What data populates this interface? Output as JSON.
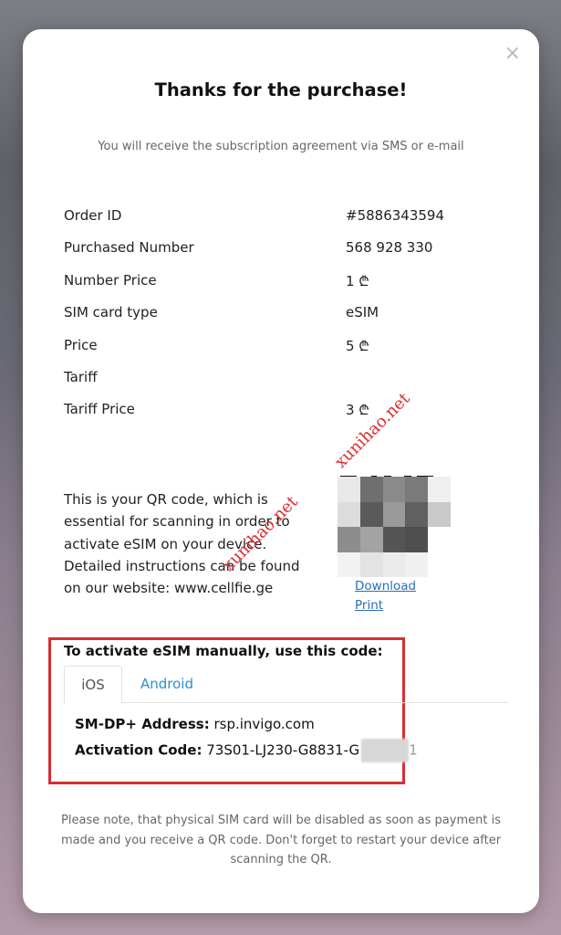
{
  "modal": {
    "close_label": "×",
    "title": "Thanks for the purchase!",
    "subtitle": "You will receive the subscription agreement via SMS or e-mail"
  },
  "order_details": [
    {
      "label": "Order ID",
      "value": "#5886343594"
    },
    {
      "label": "Purchased Number",
      "value": "568 928 330"
    },
    {
      "label": "Number Price",
      "value": "1 ₾"
    },
    {
      "label": "SIM card type",
      "value": "eSIM"
    },
    {
      "label": "Price",
      "value": "5 ₾"
    },
    {
      "label": "Tariff",
      "value": ""
    },
    {
      "label": "Tariff Price",
      "value": "3 ₾"
    }
  ],
  "qr_section": {
    "description": "This is your QR code, which is essential for scanning in order to activate eSIM on your device. Detailed instructions can be found on our website: www.cellfie.ge",
    "download_label": "Download",
    "print_label": "Print"
  },
  "manual_activation": {
    "title": "To activate eSIM manually, use this code:",
    "tabs": [
      "iOS",
      "Android"
    ],
    "active_tab": "iOS",
    "smdp_label": "SM-DP+ Address:",
    "smdp_value": "rsp.invigo.com",
    "activation_label": "Activation Code:",
    "activation_value": "73S01-LJ230-G8831-G",
    "activation_tail": "1"
  },
  "footer_note": "Please note, that physical SIM card will be disabled as soon as payment is made and you receive a QR code. Don't forget to restart your device after scanning the QR.",
  "watermarks": [
    "xunihao.net",
    "xunihao.net"
  ],
  "colors": {
    "accent_link": "#2b6fb6",
    "tab_active_link": "#2a8fcc",
    "highlight_box": "#d52f35",
    "watermark": "#e02a2a"
  }
}
